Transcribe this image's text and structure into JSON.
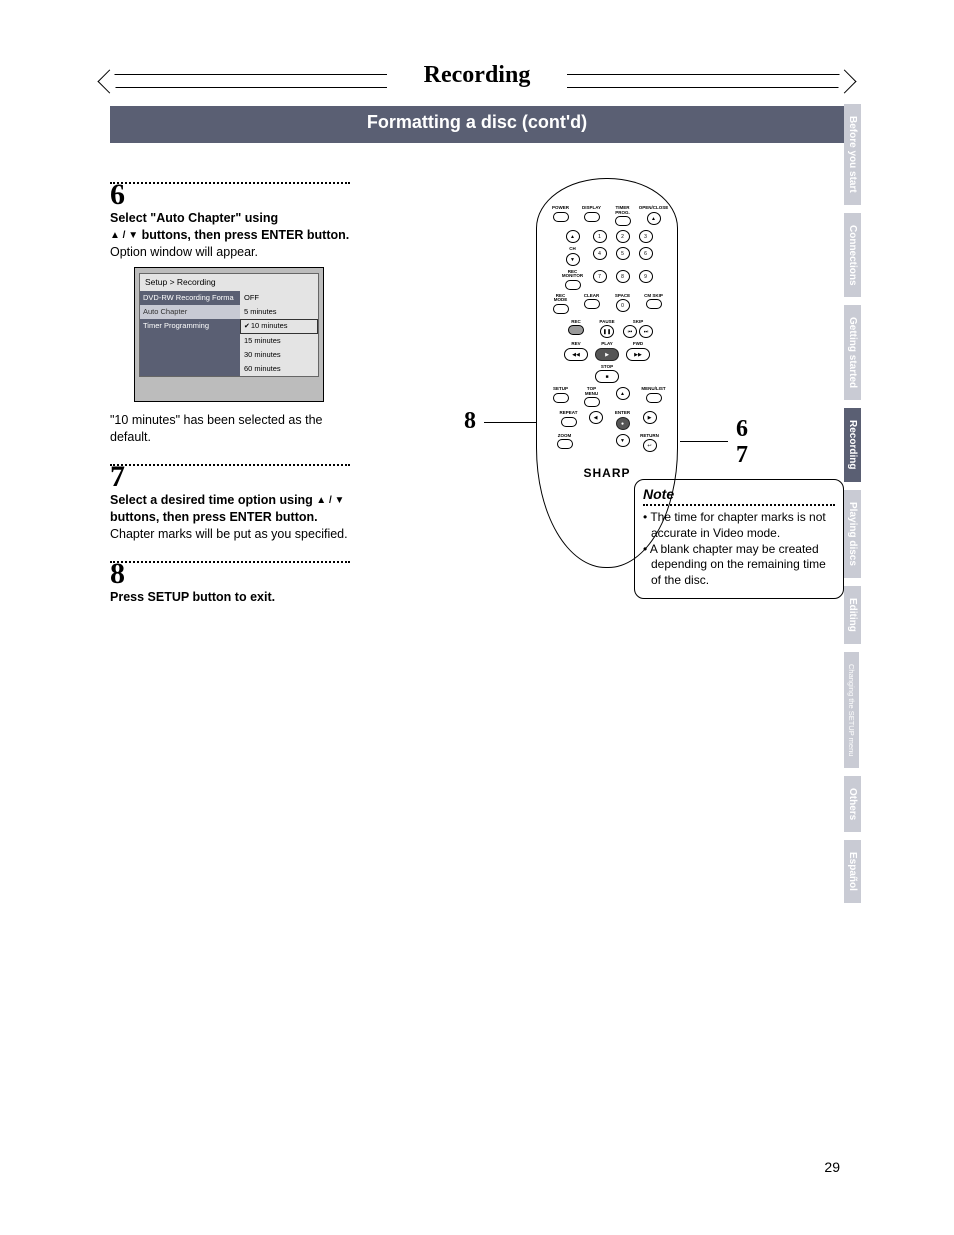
{
  "header": {
    "title": "Recording",
    "subtitle": "Formatting a disc (cont'd)"
  },
  "steps": {
    "s6": {
      "num": "6",
      "bold_a": "Select \"Auto Chapter\" using",
      "arrows": "▲ / ▼",
      "bold_b": " buttons, then press ENTER button.",
      "text": "Option window will appear.",
      "after": "\"10 minutes\" has been selected as the default."
    },
    "s7": {
      "num": "7",
      "bold_a": "Select a desired time option using ",
      "arrows": "▲ / ▼",
      "bold_b": " buttons, then press ENTER button.",
      "text": "Chapter marks will be put as you specified."
    },
    "s8": {
      "num": "8",
      "bold": "Press SETUP button to exit."
    }
  },
  "osd": {
    "crumb": "Setup > Recording",
    "rows": [
      "DVD-RW Recording Forma",
      "Auto Chapter",
      "Timer Programming"
    ],
    "options": [
      "OFF",
      "5 minutes",
      "10 minutes",
      "15 minutes",
      "30 minutes",
      "60 minutes"
    ],
    "selected_index": 2
  },
  "remote": {
    "brand": "SHARP",
    "top_labels": [
      "POWER",
      "",
      "DISPLAY",
      "TIMER PROG.",
      "OPEN/CLOSE"
    ],
    "keypad": {
      "row1": [
        "@!. 1",
        "ABC 2",
        "DEF 3"
      ],
      "row2": [
        "GHI 4",
        "JKL 5",
        "MNO 6"
      ],
      "row3": [
        "PQRS 7",
        "TUV 8",
        "WXYZ 9"
      ],
      "row4_lbl": [
        "REC MODE",
        "CLEAR",
        "SPACE",
        "CM SKIP"
      ],
      "row4": [
        "",
        "",
        "0",
        ""
      ]
    },
    "rec_row": [
      "REC",
      "PAUSE",
      "SKIP"
    ],
    "play_row": [
      "REV",
      "PLAY",
      "FWD"
    ],
    "stop": "STOP",
    "menu_row": [
      "SETUP",
      "TOP MENU",
      "",
      "MENU/LIST"
    ],
    "nav_row": [
      "REPEAT",
      "",
      "ENTER",
      ""
    ],
    "bot_row": [
      "ZOOM",
      "",
      "",
      "RETURN"
    ]
  },
  "callouts": {
    "c8": "8",
    "c6": "6",
    "c7": "7"
  },
  "note": {
    "title": "Note",
    "items": [
      "The time for chapter marks is not accurate in Video mode.",
      "A blank chapter may be created depending on the remaining time of the disc."
    ]
  },
  "tabs": [
    {
      "label": "Before you start",
      "style": "faded"
    },
    {
      "label": "Connections",
      "style": "faded"
    },
    {
      "label": "Getting started",
      "style": "faded"
    },
    {
      "label": "Recording",
      "style": "active"
    },
    {
      "label": "Playing discs",
      "style": "faded"
    },
    {
      "label": "Editing",
      "style": "faded"
    },
    {
      "label": "Changing the SETUP menu",
      "style": "vfaded"
    },
    {
      "label": "Others",
      "style": "faded"
    },
    {
      "label": "Español",
      "style": "faded"
    }
  ],
  "page_number": "29"
}
